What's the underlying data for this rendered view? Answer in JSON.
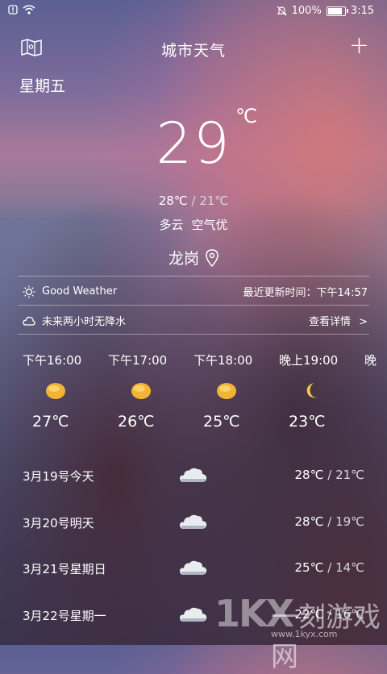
{
  "status_bar": {
    "battery_percent": "100%",
    "time": "3:15",
    "icons": [
      "alert-icon",
      "wifi-icon",
      "mute-icon",
      "battery-icon"
    ]
  },
  "header": {
    "title": "城市天气",
    "add_label": "+",
    "map_icon": "map-icon"
  },
  "weather": {
    "weekday": "星期五",
    "current_temp": "29",
    "temp_unit": "℃",
    "high": "28℃",
    "low": "21℃",
    "range_separator": "/",
    "condition": "多云",
    "air_quality": "空气优",
    "city": "龙岗"
  },
  "info": {
    "good_weather": "Good Weather",
    "update_text": "最近更新时间：下午14:57",
    "rain_text": "未来两小时无降水",
    "details_link": "查看详情",
    "details_arrow": ">"
  },
  "hourly": [
    {
      "time": "下午16:00",
      "temp": "27℃",
      "icon": "sun-icon"
    },
    {
      "time": "下午17:00",
      "temp": "26℃",
      "icon": "sun-icon"
    },
    {
      "time": "下午18:00",
      "temp": "25℃",
      "icon": "sun-icon"
    },
    {
      "time": "晚上19:00",
      "temp": "23℃",
      "icon": "moon-icon"
    },
    {
      "time": "晚",
      "temp": "",
      "icon": ""
    }
  ],
  "daily": [
    {
      "date": "3月19号今天",
      "high": "28℃",
      "low": "21℃",
      "icon": "cloudy-icon"
    },
    {
      "date": "3月20号明天",
      "high": "28℃",
      "low": "19℃",
      "icon": "cloudy-icon"
    },
    {
      "date": "3月21号星期日",
      "high": "25℃",
      "low": "14℃",
      "icon": "cloudy-icon"
    },
    {
      "date": "3月22号星期一",
      "high": "22℃",
      "low": "16℃",
      "icon": "cloudy-icon"
    }
  ],
  "watermark": {
    "logo": "1KX",
    "name": "一刻游戏网",
    "url": "www.1kyx.com"
  },
  "colors": {
    "sun": "#f2b533",
    "moon": "#f5c84a",
    "cloud": "#e8ebf0"
  }
}
